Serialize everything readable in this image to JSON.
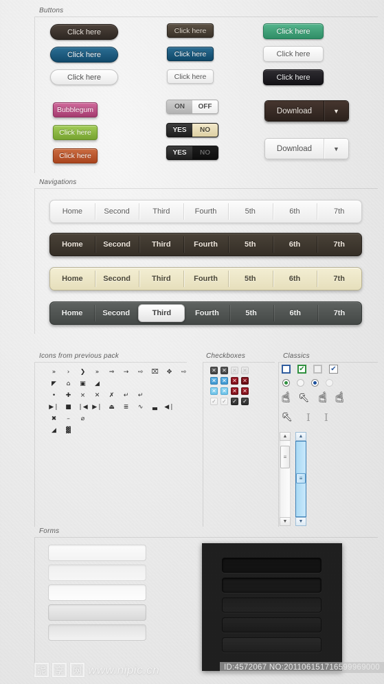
{
  "sections": {
    "buttons": "Buttons",
    "navigations": "Navigations",
    "icons": "Icons from previous pack",
    "checkboxes": "Checkboxes",
    "classics": "Classics",
    "forms": "Forms"
  },
  "buttons": {
    "col1": [
      {
        "label": "Click here",
        "style": "pill-dark"
      },
      {
        "label": "Click here",
        "style": "pill-blue"
      },
      {
        "label": "Click here",
        "style": "pill-white"
      }
    ],
    "col2": [
      {
        "label": "Click here",
        "style": "rect-dark"
      },
      {
        "label": "Click here",
        "style": "rect-blue"
      },
      {
        "label": "Click here",
        "style": "rect-white"
      }
    ],
    "col3": [
      {
        "label": "Click here",
        "style": "wide-green"
      },
      {
        "label": "Click here",
        "style": "wide-white"
      },
      {
        "label": "Click here",
        "style": "wide-black"
      }
    ],
    "colorful": [
      {
        "label": "Bubblegum",
        "style": "c-bubble",
        "color": "#b84a7c"
      },
      {
        "label": "Click here",
        "style": "c-green",
        "color": "#8cb93f"
      },
      {
        "label": "Click here",
        "style": "c-orange",
        "color": "#b9542c"
      }
    ]
  },
  "toggles": [
    {
      "on": "ON",
      "off": "OFF",
      "style": "light",
      "selected": "off"
    },
    {
      "on": "YES",
      "off": "NO",
      "style": "dark-cream",
      "selected": "off"
    },
    {
      "on": "YES",
      "off": "NO",
      "style": "dark",
      "selected": "on"
    }
  ],
  "download_buttons": [
    {
      "label": "Download",
      "arrow": "▼",
      "style": "dark"
    },
    {
      "label": "Download",
      "arrow": "▼",
      "style": "light"
    }
  ],
  "navigations": [
    {
      "style": "white",
      "items": [
        "Home",
        "Second",
        "Third",
        "Fourth",
        "5th",
        "6th",
        "7th"
      ],
      "active": -1
    },
    {
      "style": "dark",
      "items": [
        "Home",
        "Second",
        "Third",
        "Fourth",
        "5th",
        "6th",
        "7th"
      ],
      "active": -1
    },
    {
      "style": "cream",
      "items": [
        "Home",
        "Second",
        "Third",
        "Fourth",
        "5th",
        "6th",
        "7th"
      ],
      "active": -1
    },
    {
      "style": "gray",
      "items": [
        "Home",
        "Second",
        "Third",
        "Fourth",
        "5th",
        "6th",
        "7th"
      ],
      "active": 2
    }
  ],
  "icon_rows": [
    [
      "»",
      "›",
      "❯",
      "»",
      "⇒",
      "→",
      "⇨",
      "⌧",
      "✥",
      "⇨"
    ],
    [
      "◤",
      "⌂",
      "▣",
      "◢"
    ],
    [
      "•",
      "✚",
      "×",
      "✕",
      "✗",
      "↵",
      "↵"
    ],
    [
      "▶❘",
      "■",
      "❘◀",
      "▶❘",
      "⏏",
      "≣",
      "∿",
      "▃",
      "◀❘"
    ],
    [
      "✖",
      "–",
      "⌀"
    ],
    [
      "◢",
      "▓"
    ]
  ],
  "checkbox_rows": [
    [
      {
        "glyph": "✕",
        "style": "cb-dark"
      },
      {
        "glyph": "✕",
        "style": "cb-dark"
      },
      {
        "glyph": "✕",
        "style": "cb-dim"
      },
      {
        "glyph": "✕",
        "style": "cb-dim"
      }
    ],
    [
      {
        "glyph": "✕",
        "style": "cb-blue"
      },
      {
        "glyph": "✕",
        "style": "cb-blue"
      },
      {
        "glyph": "✕",
        "style": "cb-red"
      },
      {
        "glyph": "✕",
        "style": "cb-dred"
      }
    ],
    [
      {
        "glyph": "✕",
        "style": "cb-lblue"
      },
      {
        "glyph": "✕",
        "style": "cb-lblue"
      },
      {
        "glyph": "✕",
        "style": "cb-red"
      },
      {
        "glyph": "✕",
        "style": "cb-red"
      }
    ],
    [
      {
        "glyph": "✓",
        "style": "cb-wht"
      },
      {
        "glyph": "✓",
        "style": "cb-wht"
      },
      {
        "glyph": "✓",
        "style": "cb-blk"
      },
      {
        "glyph": "✓",
        "style": "cb-blk"
      }
    ]
  ],
  "classics": {
    "checkboxes": [
      {
        "glyph": "",
        "style": "b1"
      },
      {
        "glyph": "✔",
        "style": "b2"
      },
      {
        "glyph": "",
        "style": "b3"
      },
      {
        "glyph": "✔",
        "style": "b4"
      }
    ],
    "radios": [
      "r1",
      "r2",
      "r3",
      "r4"
    ],
    "cursors_row1": [
      "☝",
      "↖",
      "☝",
      "☝"
    ],
    "cursors_row2": [
      "↖"
    ],
    "ibeams": [
      "I",
      "I"
    ]
  },
  "scrollbars": [
    {
      "style": "gray",
      "up": "▲",
      "down": "▼",
      "grip": "≡",
      "thumb_top_pct": 6,
      "thumb_height_pct": 30
    },
    {
      "style": "blue",
      "up": "▲",
      "down": "▼",
      "grip": "≡",
      "thumb_top_pct": 42,
      "thumb_height_pct": 14
    }
  ],
  "forms": {
    "light_fields": [
      "f1",
      "f2",
      "f3",
      "f4",
      "f5"
    ],
    "dark_fields": [
      "d1",
      "d2",
      "d3",
      "d4",
      "d5"
    ]
  },
  "watermark": {
    "logo_chars": [
      "昵",
      "享",
      "网"
    ],
    "url": "www.nipic.cn",
    "id_text": "ID:4572067 NO:201106151716599969000"
  }
}
